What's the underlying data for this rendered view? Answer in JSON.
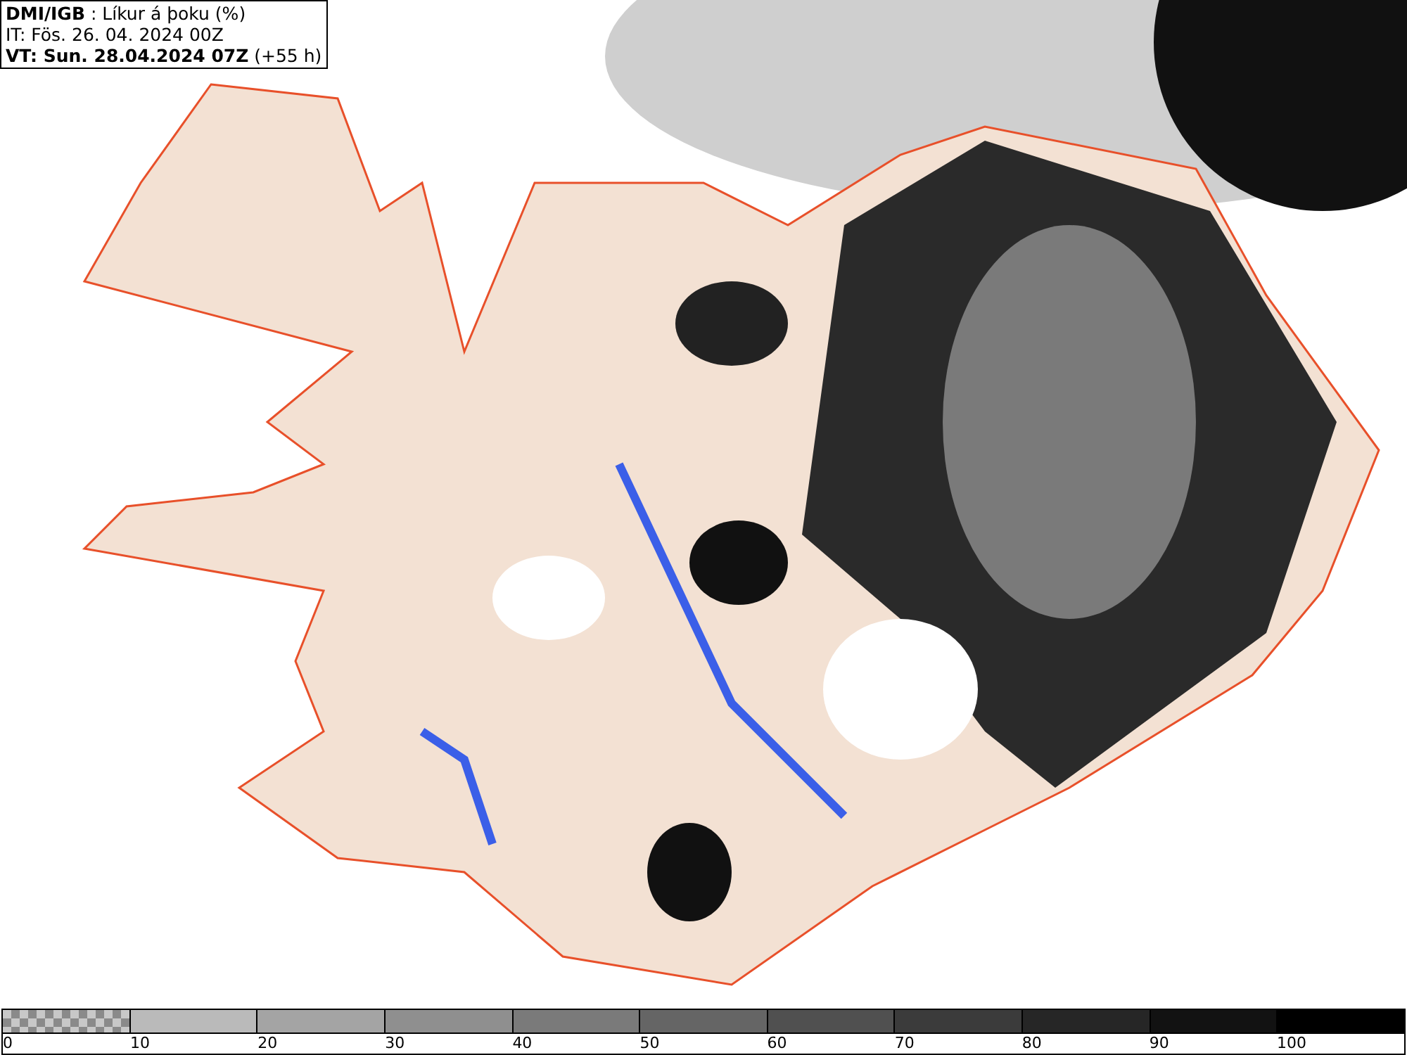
{
  "header": {
    "lines": [
      "**DMI/IGB** : Líkur á þoku (%)",
      "IT: Fös. 26. 04. 2024 00Z",
      "**VT: Sun. 28.04.2024 07Z** (+55 h)"
    ]
  },
  "colorbar": [
    {
      "kind": "checker",
      "color": "#8a8a8a",
      "label": "0"
    },
    {
      "kind": "solid",
      "color": "#bababa",
      "label": "10"
    },
    {
      "kind": "solid",
      "color": "#a4a4a4",
      "label": "20"
    },
    {
      "kind": "solid",
      "color": "#8f8f8f",
      "label": "30"
    },
    {
      "kind": "solid",
      "color": "#7a7a7a",
      "label": "40"
    },
    {
      "kind": "solid",
      "color": "#656565",
      "label": "50"
    },
    {
      "kind": "solid",
      "color": "#505050",
      "label": "60"
    },
    {
      "kind": "solid",
      "color": "#3b3b3b",
      "label": "70"
    },
    {
      "kind": "solid",
      "color": "#262626",
      "label": "80"
    },
    {
      "kind": "solid",
      "color": "#121212",
      "label": "90"
    },
    {
      "kind": "solid",
      "color": "#000000",
      "label": "100"
    }
  ]
}
